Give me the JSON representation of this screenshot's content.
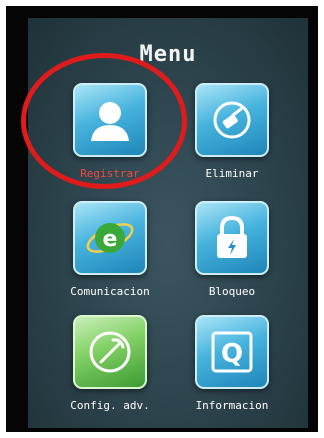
{
  "screen": {
    "title": "Menu"
  },
  "menu": {
    "items": [
      {
        "label": "Registrar",
        "icon": "user-icon",
        "selected": true
      },
      {
        "label": "Eliminar",
        "icon": "eraser-icon",
        "selected": false
      },
      {
        "label": "Comunicacion",
        "icon": "globe-e-icon",
        "selected": false
      },
      {
        "label": "Bloqueo",
        "icon": "lock-icon",
        "selected": false
      },
      {
        "label": "Config. adv.",
        "icon": "tools-icon",
        "selected": false
      },
      {
        "label": "Informacion",
        "icon": "info-q-icon",
        "selected": false
      }
    ]
  },
  "colors": {
    "highlight_ring": "#e01b1b",
    "selected_label": "#f04a3a",
    "screen_bg": "#2c434c"
  }
}
